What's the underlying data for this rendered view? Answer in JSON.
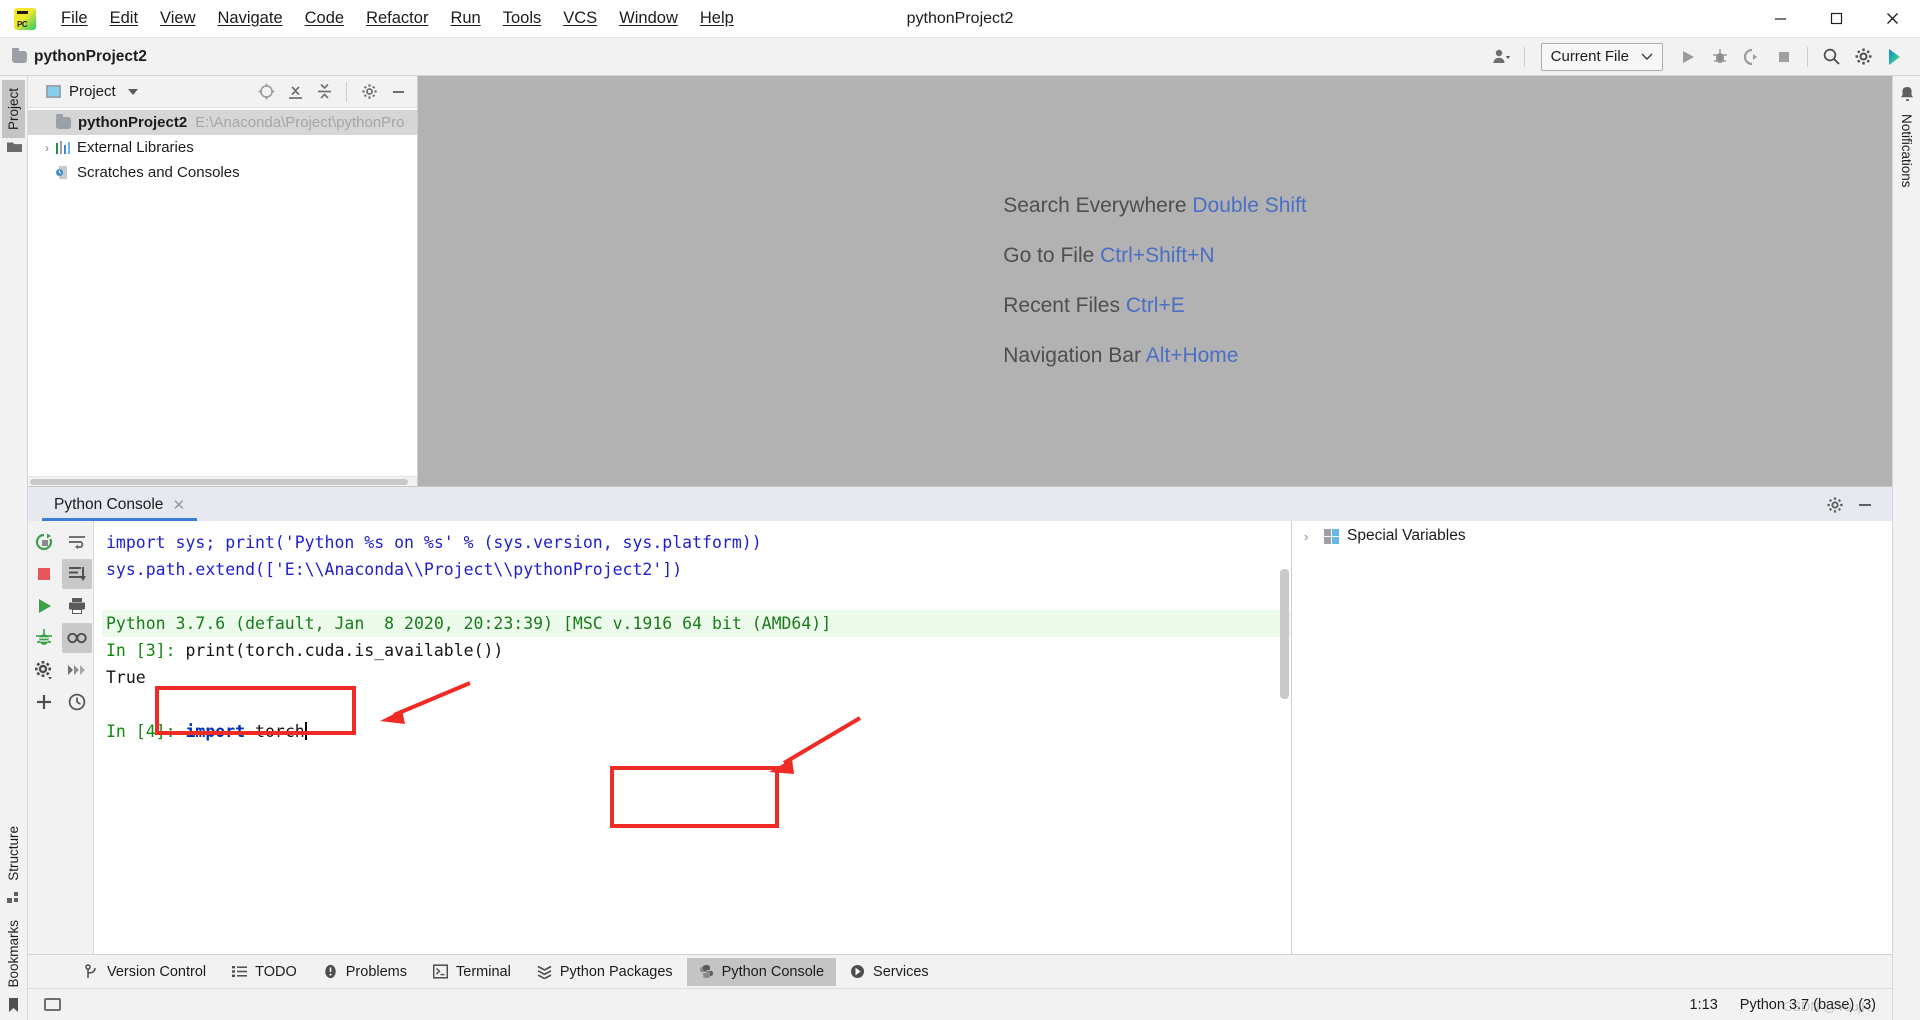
{
  "window": {
    "title": "pythonProject2",
    "minimize_label": "─",
    "maximize_label": "❐",
    "close_label": "✕"
  },
  "menu": {
    "items": [
      {
        "label": "File",
        "mnemonic": "F"
      },
      {
        "label": "Edit",
        "mnemonic": "E"
      },
      {
        "label": "View",
        "mnemonic": "V"
      },
      {
        "label": "Navigate",
        "mnemonic": "N"
      },
      {
        "label": "Code",
        "mnemonic": "C"
      },
      {
        "label": "Refactor",
        "mnemonic": "R"
      },
      {
        "label": "Run",
        "mnemonic": "u"
      },
      {
        "label": "Tools",
        "mnemonic": "T"
      },
      {
        "label": "VCS",
        "mnemonic": "S"
      },
      {
        "label": "Window",
        "mnemonic": "W"
      },
      {
        "label": "Help",
        "mnemonic": "H"
      }
    ]
  },
  "toolbar": {
    "breadcrumb": "pythonProject2",
    "run_config": "Current File",
    "icons": [
      "user-account-icon",
      "run-icon",
      "debug-icon",
      "coverage-icon",
      "stop-icon",
      "search-everywhere-icon",
      "settings-icon",
      "ide-assistant-icon"
    ]
  },
  "left_sidebar": {
    "items": [
      {
        "label": "Project",
        "icon": "project-folder-icon",
        "active": true
      },
      {
        "label": "Structure",
        "icon": "structure-icon",
        "active": false
      },
      {
        "label": "Bookmarks",
        "icon": "bookmark-icon",
        "active": false
      }
    ]
  },
  "right_sidebar": {
    "items": [
      {
        "label": "Notifications",
        "icon": "bell-icon"
      }
    ]
  },
  "project_pane": {
    "title": "Project",
    "toolbar_icons": [
      "locate-target-icon",
      "expand-all-icon",
      "collapse-all-icon",
      "gear-icon",
      "minimize-icon"
    ],
    "tree": [
      {
        "label": "pythonProject2",
        "path": "E:\\Anaconda\\Project\\pythonPro",
        "icon": "folder-icon",
        "selected": true,
        "bold": true,
        "caret": ""
      },
      {
        "label": "External Libraries",
        "path": "",
        "icon": "library-icon",
        "selected": false,
        "bold": false,
        "caret": "›"
      },
      {
        "label": "Scratches and Consoles",
        "path": "",
        "icon": "scratches-icon",
        "selected": false,
        "bold": false,
        "caret": ""
      }
    ]
  },
  "editor": {
    "hints": [
      {
        "action": "Search Everywhere",
        "shortcut": "Double Shift"
      },
      {
        "action": "Go to File",
        "shortcut": "Ctrl+Shift+N"
      },
      {
        "action": "Recent Files",
        "shortcut": "Ctrl+E"
      },
      {
        "action": "Navigation Bar",
        "shortcut": "Alt+Home"
      }
    ]
  },
  "console": {
    "tab_label": "Python Console",
    "tab_close": "✕",
    "header_icons": [
      "gear-icon",
      "minimize-icon"
    ],
    "left_toolbar": [
      "rerun-icon",
      "stop-icon",
      "execute-icon",
      "debug-icon",
      "settings-icon",
      "new-console-icon"
    ],
    "right_toolbar": [
      "soft-wrap-icon",
      "scroll-to-end-icon",
      "print-icon",
      "show-variables-icon",
      "execute-all-icon",
      "history-icon"
    ],
    "lines": [
      {
        "type": "input-echo",
        "text": "import sys; print('Python %s on %s' % (sys.version, sys.platform))"
      },
      {
        "type": "input-echo",
        "text": "sys.path.extend(['E:\\\\Anaconda\\\\Project\\\\pythonProject2'])"
      },
      {
        "type": "blank",
        "text": ""
      },
      {
        "type": "version",
        "text": "Python 3.7.6 (default, Jan  8 2020, 20:23:39) [MSC v.1916 64 bit (AMD64)]"
      },
      {
        "type": "prompt",
        "prompt": "In [3]:",
        "code": "print(torch.cuda.is_available())"
      },
      {
        "type": "output",
        "text": "True"
      },
      {
        "type": "blank",
        "text": ""
      },
      {
        "type": "prompt-active",
        "prompt": "In [4]:",
        "keyword": "import",
        "code": " torch"
      }
    ]
  },
  "variables": {
    "title": "Special Variables",
    "caret": "›",
    "icon": "special-variables-icon"
  },
  "bottom_bar": {
    "tabs": [
      {
        "label": "Version Control",
        "icon": "branch-icon",
        "active": false
      },
      {
        "label": "TODO",
        "icon": "todo-list-icon",
        "active": false
      },
      {
        "label": "Problems",
        "icon": "problems-icon",
        "active": false
      },
      {
        "label": "Terminal",
        "icon": "terminal-icon",
        "active": false
      },
      {
        "label": "Python Packages",
        "icon": "packages-icon",
        "active": false
      },
      {
        "label": "Python Console",
        "icon": "python-icon",
        "active": true
      },
      {
        "label": "Services",
        "icon": "services-icon",
        "active": false
      }
    ]
  },
  "status_bar": {
    "caret_position": "1:13",
    "interpreter": "Python 3.7 (base) (3)",
    "watermark": "CSDN @YoujK"
  },
  "colors": {
    "accent_blue": "#3b7dd8",
    "annotation_red": "#ee2b24",
    "keyword_blue": "#0033b3",
    "console_blue": "#2020cf",
    "prompt_green": "#0f8a0f",
    "version_green": "#1a7b1a",
    "editor_bg": "#b2b2b2"
  }
}
